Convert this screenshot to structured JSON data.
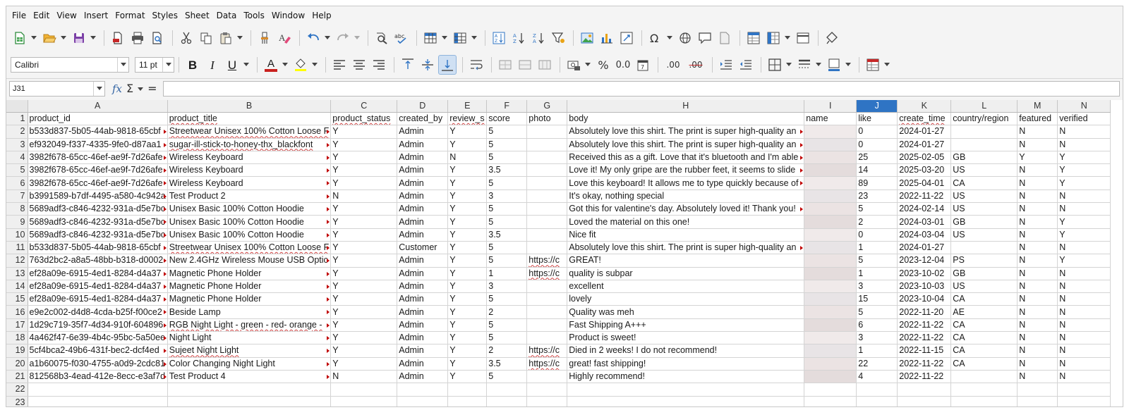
{
  "menu": [
    "File",
    "Edit",
    "View",
    "Insert",
    "Format",
    "Styles",
    "Sheet",
    "Data",
    "Tools",
    "Window",
    "Help"
  ],
  "format_toolbar": {
    "font_name": "Calibri",
    "font_size": "11 pt",
    "bold": "B",
    "italic": "I",
    "underline": "U",
    "font_color_letter": "A",
    "percent": "%",
    "number_format": "0.0",
    "add_decimal": ".00",
    "delete_decimal": ".00"
  },
  "formula_bar": {
    "cell_ref": "J31",
    "fx": "fx",
    "sigma": "Σ",
    "equals": "=",
    "content": ""
  },
  "colors": {
    "selected_header": "#2f74c4",
    "truncation_marker": "#c00000",
    "spell_underline": "#d04040"
  },
  "sheet": {
    "selected_column": "J",
    "columns": [
      "A",
      "B",
      "C",
      "D",
      "E",
      "F",
      "G",
      "H",
      "I",
      "J",
      "K",
      "L",
      "M",
      "N"
    ],
    "headers": [
      "product_id",
      "product_title",
      "product_status",
      "created_by",
      "review_s",
      "score",
      "photo",
      "body",
      "name",
      "like",
      "create_time",
      "country/region",
      "featured",
      "verified"
    ],
    "rows": [
      [
        "b533d837-5b05-44ab-9818-65cbf",
        "Streetwear Unisex 100% Cotton Loose F",
        "Y",
        "Admin",
        "Y",
        "5",
        "",
        "Absolutely love this shirt. The print is super high-quality an",
        "",
        "0",
        "2024-01-27",
        "",
        "N",
        "N"
      ],
      [
        "ef932049-f337-4335-9fe0-d87aa1",
        "sugar-ill-stick-to-honey-thx_blackfont",
        "Y",
        "Admin",
        "Y",
        "5",
        "",
        "Absolutely love this shirt. The print is super high-quality an",
        "",
        "0",
        "2024-01-27",
        "",
        "N",
        "N"
      ],
      [
        "3982f678-65cc-46ef-ae9f-7d26afe",
        "Wireless Keyboard",
        "Y",
        "Admin",
        "N",
        "5",
        "",
        "Received this as a gift. Love that it's bluetooth and I'm able",
        "",
        "25",
        "2025-02-05",
        "GB",
        "Y",
        "Y"
      ],
      [
        "3982f678-65cc-46ef-ae9f-7d26afe",
        "Wireless Keyboard",
        "Y",
        "Admin",
        "Y",
        "3.5",
        "",
        "Love it! My only gripe are the rubber feet, it seems to slide",
        "",
        "14",
        "2025-03-20",
        "US",
        "N",
        "Y"
      ],
      [
        "3982f678-65cc-46ef-ae9f-7d26afe",
        "Wireless Keyboard",
        "Y",
        "Admin",
        "Y",
        "5",
        "",
        "Love this keyboard! It allows me to type quickly because of",
        "",
        "89",
        "2025-04-01",
        "CA",
        "N",
        "Y"
      ],
      [
        "b3991589-b7df-4495-a580-4c942a",
        "Test Product 2",
        "N",
        "Admin",
        "Y",
        "3",
        "",
        "It's okay, nothing special",
        "",
        "23",
        "2022-11-22",
        "US",
        "N",
        "N"
      ],
      [
        "5689adf3-c846-4232-931a-d5e7bc",
        "Unisex Basic 100% Cotton Hoodie",
        "Y",
        "Admin",
        "Y",
        "5",
        "",
        "Got this for valentine's day. Absolutely loved it! Thank you!",
        "",
        "5",
        "2024-02-14",
        "US",
        "N",
        "N"
      ],
      [
        "5689adf3-c846-4232-931a-d5e7bc",
        "Unisex Basic 100% Cotton Hoodie",
        "Y",
        "Admin",
        "Y",
        "5",
        "",
        "Loved the material on this one!",
        "",
        "2",
        "2024-03-01",
        "GB",
        "N",
        "Y"
      ],
      [
        "5689adf3-c846-4232-931a-d5e7bc",
        "Unisex Basic 100% Cotton Hoodie",
        "Y",
        "Admin",
        "Y",
        "3.5",
        "",
        "Nice fit",
        "",
        "0",
        "2024-03-04",
        "US",
        "N",
        "Y"
      ],
      [
        "b533d837-5b05-44ab-9818-65cbf",
        "Streetwear Unisex 100% Cotton Loose F",
        "Y",
        "Customer",
        "Y",
        "5",
        "",
        "Absolutely love this shirt. The print is super high-quality an",
        "",
        "1",
        "2024-01-27",
        "",
        "N",
        "N"
      ],
      [
        "763d2bc2-a8a5-48bb-b318-d0002",
        "New 2.4GHz Wireless Mouse USB Optic",
        "Y",
        "Admin",
        "Y",
        "5",
        "https://c",
        "GREAT!",
        "",
        "5",
        "2023-12-04",
        "PS",
        "N",
        "Y"
      ],
      [
        "ef28a09e-6915-4ed1-8284-d4a37",
        "Magnetic Phone Holder",
        "Y",
        "Admin",
        "Y",
        "1",
        "https://c",
        "quality is subpar",
        "",
        "1",
        "2023-10-02",
        "GB",
        "N",
        "N"
      ],
      [
        "ef28a09e-6915-4ed1-8284-d4a37",
        "Magnetic Phone Holder",
        "Y",
        "Admin",
        "Y",
        "3",
        "",
        "excellent",
        "",
        "3",
        "2023-10-03",
        "US",
        "N",
        "N"
      ],
      [
        "ef28a09e-6915-4ed1-8284-d4a37",
        "Magnetic Phone Holder",
        "Y",
        "Admin",
        "Y",
        "5",
        "",
        "lovely",
        "",
        "15",
        "2023-10-04",
        "CA",
        "N",
        "N"
      ],
      [
        "e9e2c002-d4d8-4cda-b25f-f00ce2",
        "Beside Lamp",
        "Y",
        "Admin",
        "Y",
        "2",
        "",
        "Quality was meh",
        "",
        "5",
        "2022-11-20",
        "AE",
        "N",
        "N"
      ],
      [
        "1d29c719-35f7-4d34-910f-604896",
        "RGB Night Light - green - red- orange - ",
        "Y",
        "Admin",
        "Y",
        "5",
        "",
        "Fast Shipping A+++",
        "",
        "6",
        "2022-11-22",
        "CA",
        "N",
        "N"
      ],
      [
        "4a462f47-6e39-4b4c-95bc-5a50ee",
        "Night Light",
        "Y",
        "Admin",
        "Y",
        "5",
        "",
        "Product is sweet!",
        "",
        "3",
        "2022-11-22",
        "CA",
        "N",
        "N"
      ],
      [
        "5cf4bca2-49b6-431f-bec2-dcf4ed",
        "Sujeet Night Light",
        "Y",
        "Admin",
        "Y",
        "2",
        "https://c",
        "Died in 2 weeks!  I do not recommend!",
        "",
        "1",
        "2022-11-15",
        "CA",
        "N",
        "N"
      ],
      [
        "a1b60075-f030-4755-a0d9-2cdc81",
        "Color Changing Night Light",
        "Y",
        "Admin",
        "Y",
        "3.5",
        "https://c",
        "great! fast shipping!",
        "",
        "22",
        "2022-11-22",
        "CA",
        "N",
        "N"
      ],
      [
        "812568b3-4ead-412e-8ecc-e3af7d",
        "Test Product 4",
        "N",
        "Admin",
        "Y",
        "5",
        "",
        "Highly recommend!",
        "",
        "4",
        "2022-11-22",
        "",
        "N",
        "N"
      ],
      [
        "",
        "",
        "",
        "",
        "",
        "",
        "",
        "",
        "",
        "",
        "",
        "",
        "",
        ""
      ]
    ],
    "row_numbers": [
      "1",
      "2",
      "3",
      "4",
      "5",
      "6",
      "7",
      "8",
      "9",
      "10",
      "11",
      "12",
      "13",
      "14",
      "15",
      "16",
      "17",
      "18",
      "19",
      "20",
      "21",
      "22",
      "23"
    ]
  }
}
